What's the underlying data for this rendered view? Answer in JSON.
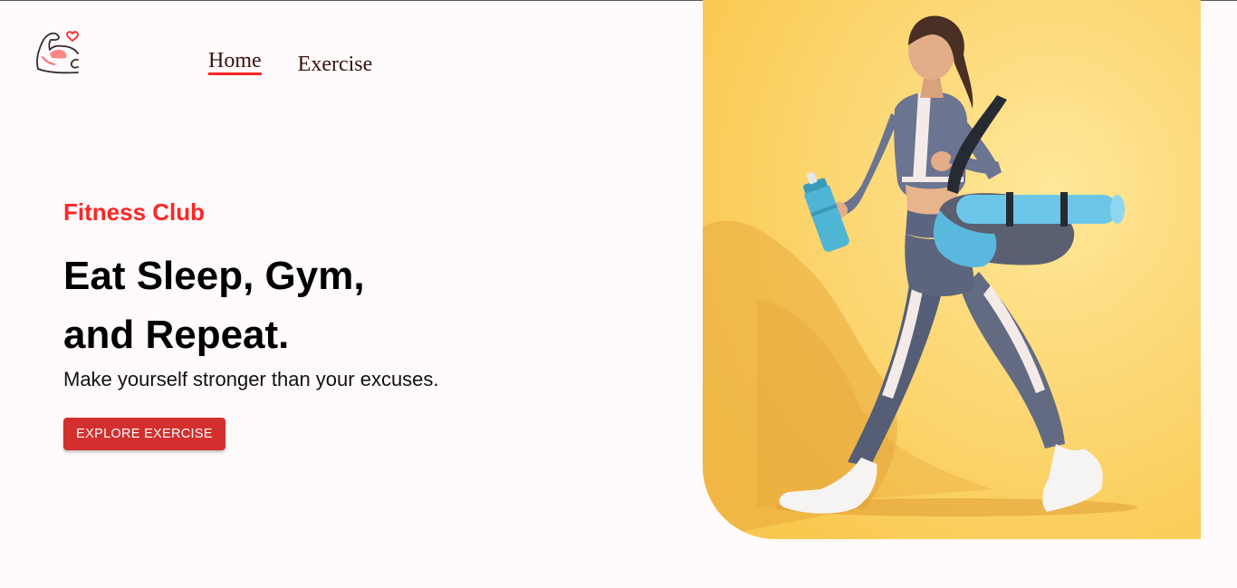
{
  "nav": {
    "logo": "flexed-arm-heart-logo",
    "items": [
      {
        "label": "Home",
        "active": true
      },
      {
        "label": "Exercise",
        "active": false
      }
    ]
  },
  "hero": {
    "subtitle": "Fitness Club",
    "title_line1": "Eat Sleep, Gym,",
    "title_line2": "and Repeat.",
    "description": "Make yourself stronger than your excuses.",
    "cta_label": "EXPLORE EXERCISE"
  },
  "colors": {
    "accent": "#ff2625",
    "button": "#d32f2f",
    "background": "#fffafb",
    "banner_bg": "#fcd670"
  }
}
